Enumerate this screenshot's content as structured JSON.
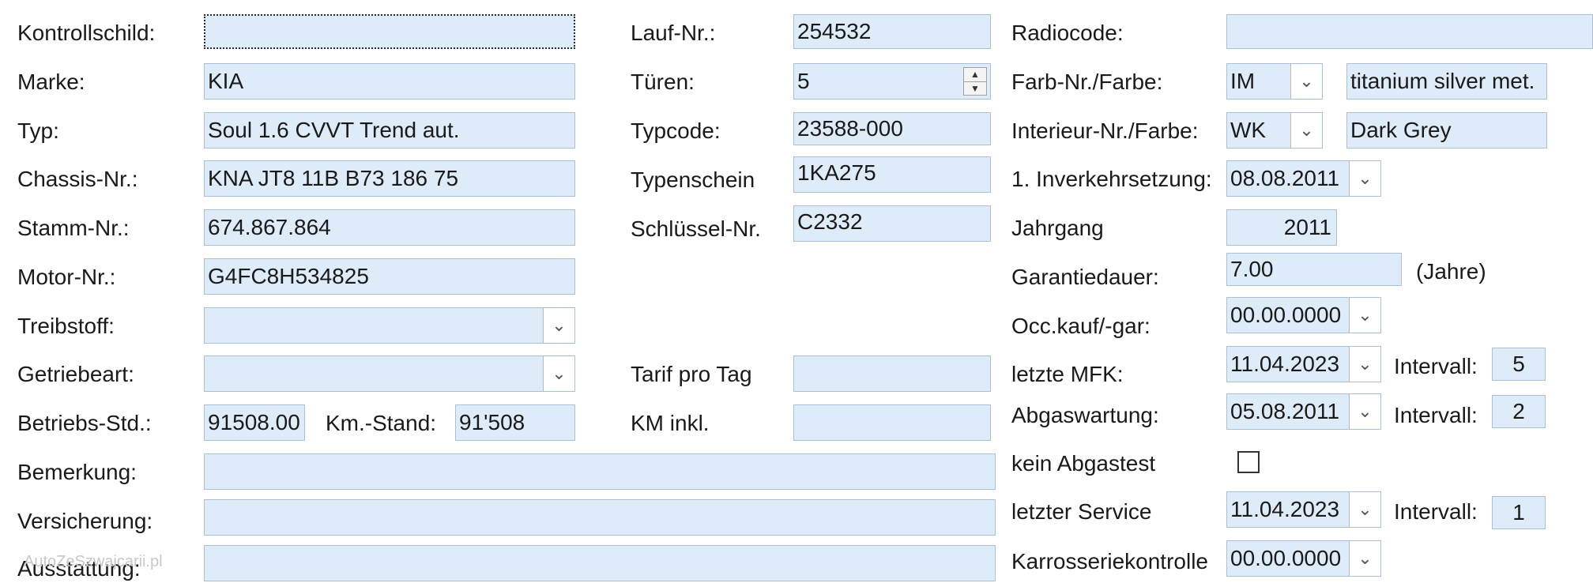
{
  "left": {
    "kontrollschild": {
      "label": "Kontrollschild:",
      "value": ""
    },
    "marke": {
      "label": "Marke:",
      "value": "KIA"
    },
    "typ": {
      "label": "Typ:",
      "value": "Soul 1.6 CVVT Trend aut."
    },
    "chassis": {
      "label": "Chassis-Nr.:",
      "value": "KNA JT8 11B B73 186 75"
    },
    "stamm": {
      "label": "Stamm-Nr.:",
      "value": "674.867.864"
    },
    "motor": {
      "label": "Motor-Nr.:",
      "value": "G4FC8H534825"
    },
    "treibstoff": {
      "label": "Treibstoff:",
      "value": ""
    },
    "getriebeart": {
      "label": "Getriebeart:",
      "value": ""
    },
    "betriebs": {
      "label": "Betriebs-Std.:",
      "value": "91508.00"
    },
    "km_stand": {
      "label": "Km.-Stand:",
      "value": "91'508"
    },
    "bemerkung": {
      "label": "Bemerkung:",
      "value": ""
    },
    "versicherung": {
      "label": "Versicherung:",
      "value": ""
    },
    "ausstattung": {
      "label": "Ausstattung:",
      "value": ""
    }
  },
  "middle": {
    "lauf": {
      "label": "Lauf-Nr.:",
      "value": "254532"
    },
    "tueren": {
      "label": "Türen:",
      "value": "5"
    },
    "typcode": {
      "label": "Typcode:",
      "value": "23588-000"
    },
    "typenschein": {
      "label": "Typenschein",
      "value": "1KA275"
    },
    "schluessel": {
      "label": "Schlüssel-Nr.",
      "value": "C2332"
    },
    "tarif": {
      "label": "Tarif pro Tag",
      "value": ""
    },
    "km_inkl": {
      "label": "KM inkl.",
      "value": ""
    }
  },
  "right": {
    "radiocode": {
      "label": "Radiocode:",
      "value": ""
    },
    "farbe": {
      "label": "Farb-Nr./Farbe:",
      "code": "IM",
      "name": "titanium silver met."
    },
    "interieur": {
      "label": "Interieur-Nr./Farbe:",
      "code": "WK",
      "name": "Dark Grey"
    },
    "inverkehr": {
      "label": "1. Inverkehrsetzung:",
      "value": "08.08.2011"
    },
    "jahrgang": {
      "label": "Jahrgang",
      "value": "2011"
    },
    "garantie": {
      "label": "Garantiedauer:",
      "value": "7.00",
      "unit": "(Jahre)"
    },
    "occ": {
      "label": "Occ.kauf/-gar:",
      "value": "00.00.0000"
    },
    "mfk": {
      "label": "letzte MFK:",
      "value": "11.04.2023",
      "interval_label": "Intervall:",
      "interval": "5"
    },
    "abgaswartung": {
      "label": "Abgaswartung:",
      "value": "05.08.2011",
      "interval_label": "Intervall:",
      "interval": "2"
    },
    "abgastest": {
      "label": "kein Abgastest",
      "checked": false
    },
    "service": {
      "label": "letzter Service",
      "value": "11.04.2023",
      "interval_label": "Intervall:",
      "interval": "1"
    },
    "karosserie": {
      "label": "Karrosseriekontrolle",
      "value": "00.00.0000"
    }
  },
  "icons": {
    "dropdown": "chevron-down-icon",
    "spinner": "spinner-arrows-icon",
    "checkbox": "checkbox-unchecked"
  },
  "watermark": "AutoZeSzwajcarii.pl",
  "colors": {
    "field_bg": "#deebf8",
    "field_border": "#a9c0d8",
    "background": "#ffffff"
  }
}
